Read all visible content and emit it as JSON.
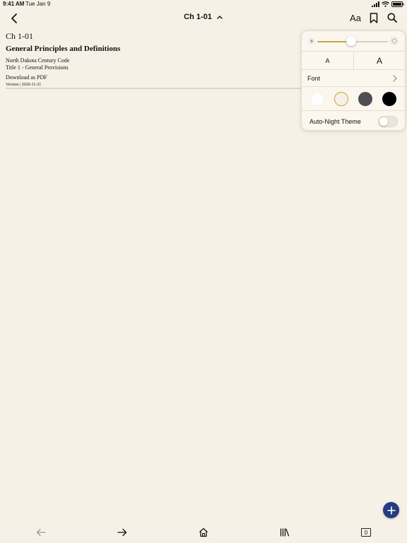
{
  "status_bar": {
    "time": "9:41 AM",
    "date": "Tue Jan 9",
    "icons": [
      "signal-icon",
      "wifi-icon",
      "battery-icon"
    ]
  },
  "nav": {
    "title": "Ch 1-01",
    "text_size_label": "Aa",
    "icons": [
      "back-chevron-icon",
      "chevron-up-icon",
      "bookmark-icon",
      "search-icon"
    ]
  },
  "document": {
    "chapter": "Ch 1-01",
    "title": "General Principles and Definitions",
    "code_name": "North Dakota Century Code",
    "title_line": "Title 1 - General Provisions",
    "download_link": "Download as PDF",
    "version": "Version | 2020-11-21"
  },
  "display_settings": {
    "brightness": 0.48,
    "brightness_icons": [
      "sun-small-icon",
      "sun-large-icon"
    ],
    "font_size_small_label": "A",
    "font_size_large_label": "A",
    "font_label": "Font",
    "themes": [
      {
        "name": "white",
        "color": "#ffffff",
        "selected": false
      },
      {
        "name": "sepia",
        "color": "#f6f1e6",
        "selected": true
      },
      {
        "name": "gray",
        "color": "#4d4d52",
        "selected": false
      },
      {
        "name": "black",
        "color": "#000000",
        "selected": false
      }
    ],
    "auto_night_label": "Auto-Night Theme",
    "auto_night_enabled": false
  },
  "fab": {
    "icon": "plus-icon",
    "color": "#253a84"
  },
  "bottom_bar": {
    "icons": [
      "arrow-left-icon",
      "arrow-right-icon",
      "home-icon",
      "library-icon",
      "tabs-count-icon"
    ],
    "tab_count": "0"
  },
  "colors": {
    "background": "#f6f1e6",
    "accent": "#c9a63a",
    "popover_bg": "#fbf7ee"
  }
}
